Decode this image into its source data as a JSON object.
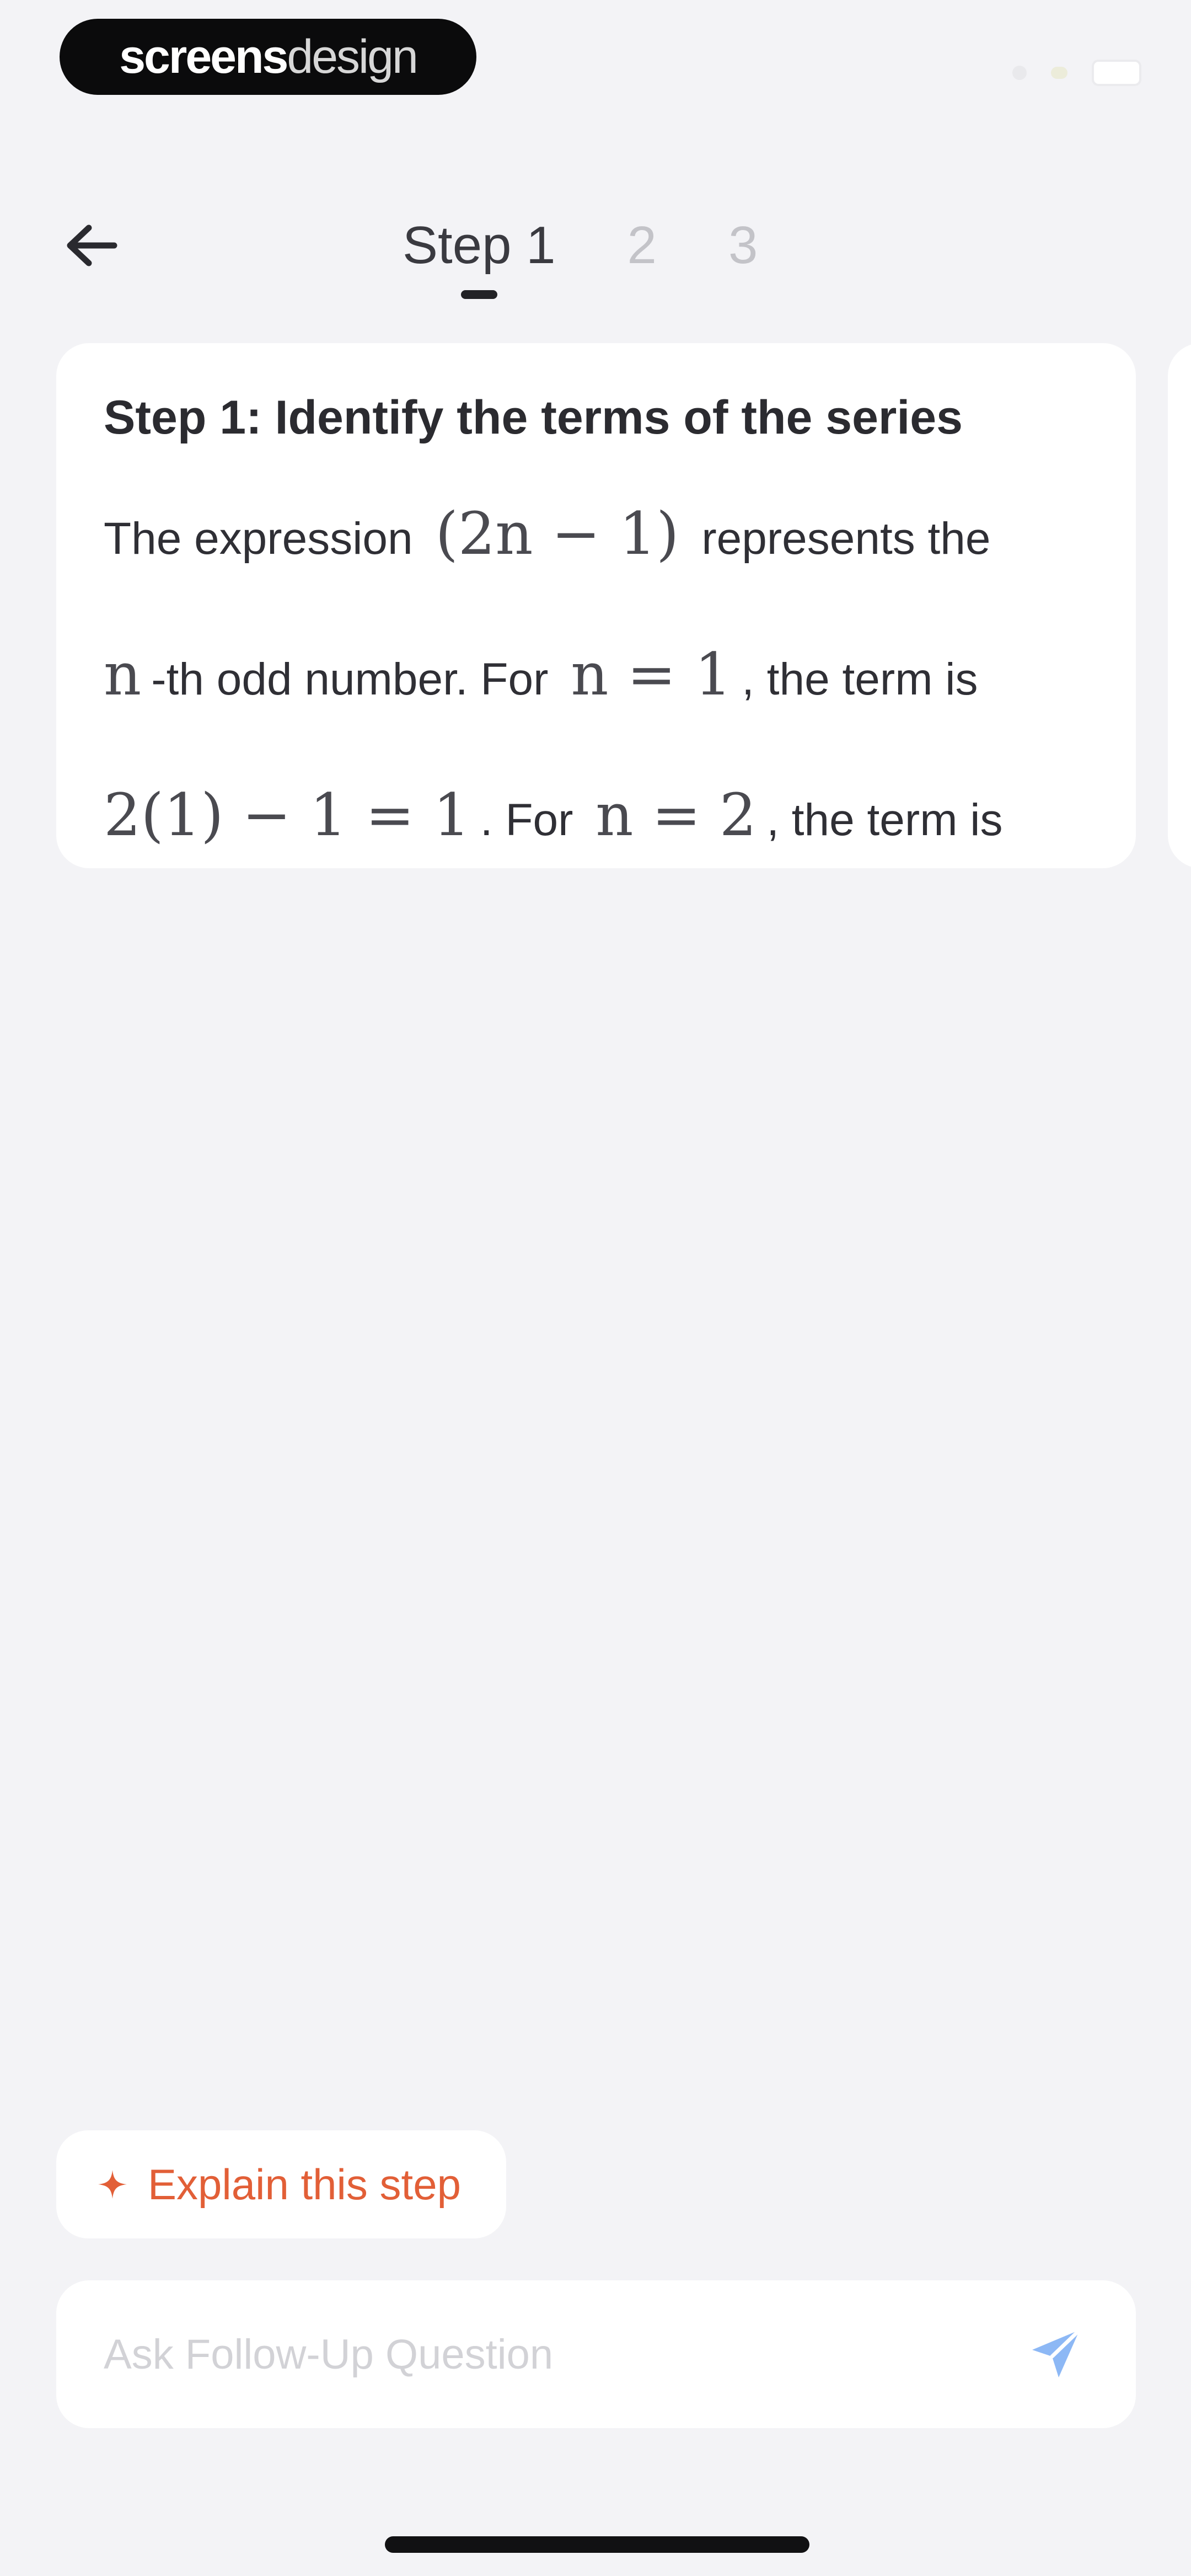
{
  "brand": {
    "strong": "screens",
    "light": "design"
  },
  "header": {
    "tabs": [
      {
        "label": "Step 1",
        "active": true
      },
      {
        "label": "2",
        "active": false
      },
      {
        "label": "3",
        "active": false
      }
    ]
  },
  "step_card": {
    "heading": "Step 1: Identify the terms of the series",
    "line1": {
      "before": "The expression",
      "math": "(2n − 1)",
      "after": "represents the"
    },
    "line2": {
      "math1": "n",
      "text1": "-th odd number. For",
      "math2": "n = 1",
      "text2": ", the term is"
    },
    "line3": {
      "math1": "2(1) − 1 = 1",
      "text1": ". For",
      "math2": "n = 2",
      "text2": ", the term is"
    }
  },
  "explain_chip": {
    "label": "Explain this step"
  },
  "ask": {
    "placeholder": "Ask Follow-Up Question",
    "value": ""
  },
  "colors": {
    "background": "#f3f3f6",
    "card": "#ffffff",
    "accent": "#e25f37",
    "send_icon": "#4a90f0"
  },
  "icons": {
    "back": "arrow-left-icon",
    "sparkle": "sparkle-icon",
    "send": "send-icon"
  }
}
